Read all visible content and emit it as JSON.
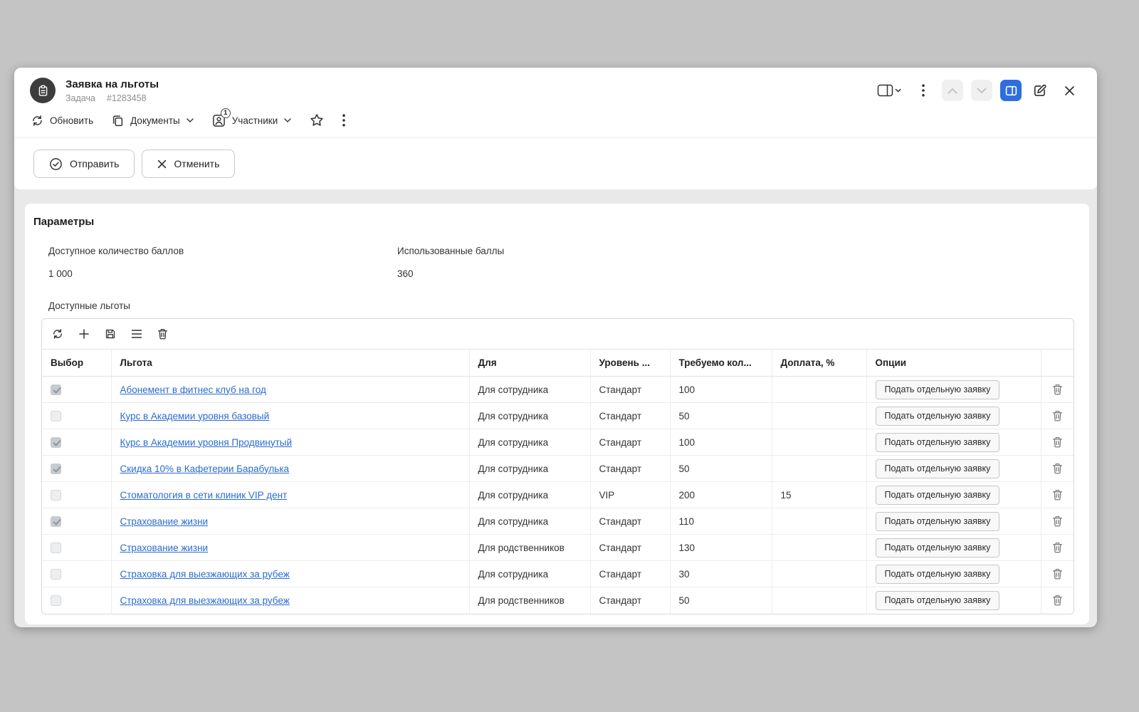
{
  "window": {
    "title": "Заявка на льготы",
    "type_label": "Задача",
    "task_id": "#1283458"
  },
  "toolbar": {
    "refresh_label": "Обновить",
    "documents_label": "Документы",
    "participants_label": "Участники",
    "participants_badge": "1"
  },
  "actions": {
    "submit_label": "Отправить",
    "cancel_label": "Отменить"
  },
  "parameters": {
    "section_title": "Параметры",
    "available_points_label": "Доступное количество баллов",
    "available_points_value": "1 000",
    "used_points_label": "Использованные баллы",
    "used_points_value": "360"
  },
  "benefits": {
    "label": "Доступные льготы",
    "table": {
      "headers": {
        "select": "Выбор",
        "benefit": "Льгота",
        "for_whom": "Для",
        "level": "Уровень ...",
        "required": "Требуемо кол...",
        "surcharge": "Доплата, %",
        "options": "Опции"
      },
      "row_action_label": "Подать отдельную заявку",
      "rows": [
        {
          "checked": true,
          "benefit": "Абонемент в фитнес клуб на год",
          "for_whom": "Для сотрудника",
          "level": "Стандарт",
          "required": "100",
          "surcharge": ""
        },
        {
          "checked": false,
          "benefit": "Курс в Академии уровня базовый",
          "for_whom": "Для сотрудника",
          "level": "Стандарт",
          "required": "50",
          "surcharge": ""
        },
        {
          "checked": true,
          "benefit": "Курс в Академии уровня Продвинутый",
          "for_whom": "Для сотрудника",
          "level": "Стандарт",
          "required": "100",
          "surcharge": ""
        },
        {
          "checked": true,
          "benefit": "Скидка 10% в Кафетерии Барабулька",
          "for_whom": "Для сотрудника",
          "level": "Стандарт",
          "required": "50",
          "surcharge": ""
        },
        {
          "checked": false,
          "benefit": "Стоматология в сети клиник VIP дент",
          "for_whom": "Для сотрудника",
          "level": "VIP",
          "required": "200",
          "surcharge": "15"
        },
        {
          "checked": true,
          "benefit": "Страхование жизни",
          "for_whom": "Для сотрудника",
          "level": "Стандарт",
          "required": "110",
          "surcharge": ""
        },
        {
          "checked": false,
          "benefit": "Страхование жизни",
          "for_whom": "Для родственников",
          "level": "Стандарт",
          "required": "130",
          "surcharge": ""
        },
        {
          "checked": false,
          "benefit": "Страховка для выезжающих за рубеж",
          "for_whom": "Для сотрудника",
          "level": "Стандарт",
          "required": "30",
          "surcharge": ""
        },
        {
          "checked": false,
          "benefit": "Страховка для выезжающих за рубеж",
          "for_whom": "Для родственников",
          "level": "Стандарт",
          "required": "50",
          "surcharge": ""
        }
      ]
    }
  },
  "icons": {
    "app": "clipboard",
    "header": [
      "view-switcher",
      "kebab-menu",
      "chevron-up",
      "chevron-down",
      "split-view",
      "edit",
      "close"
    ],
    "toolbar": [
      "refresh",
      "documents",
      "participants",
      "star",
      "kebab-menu"
    ],
    "table_toolbar": [
      "refresh",
      "add",
      "save",
      "list",
      "trash"
    ]
  },
  "colors": {
    "accent_blue": "#2e6ee0",
    "link_blue": "#2a6cce",
    "page_background": "#c4c4c4"
  }
}
